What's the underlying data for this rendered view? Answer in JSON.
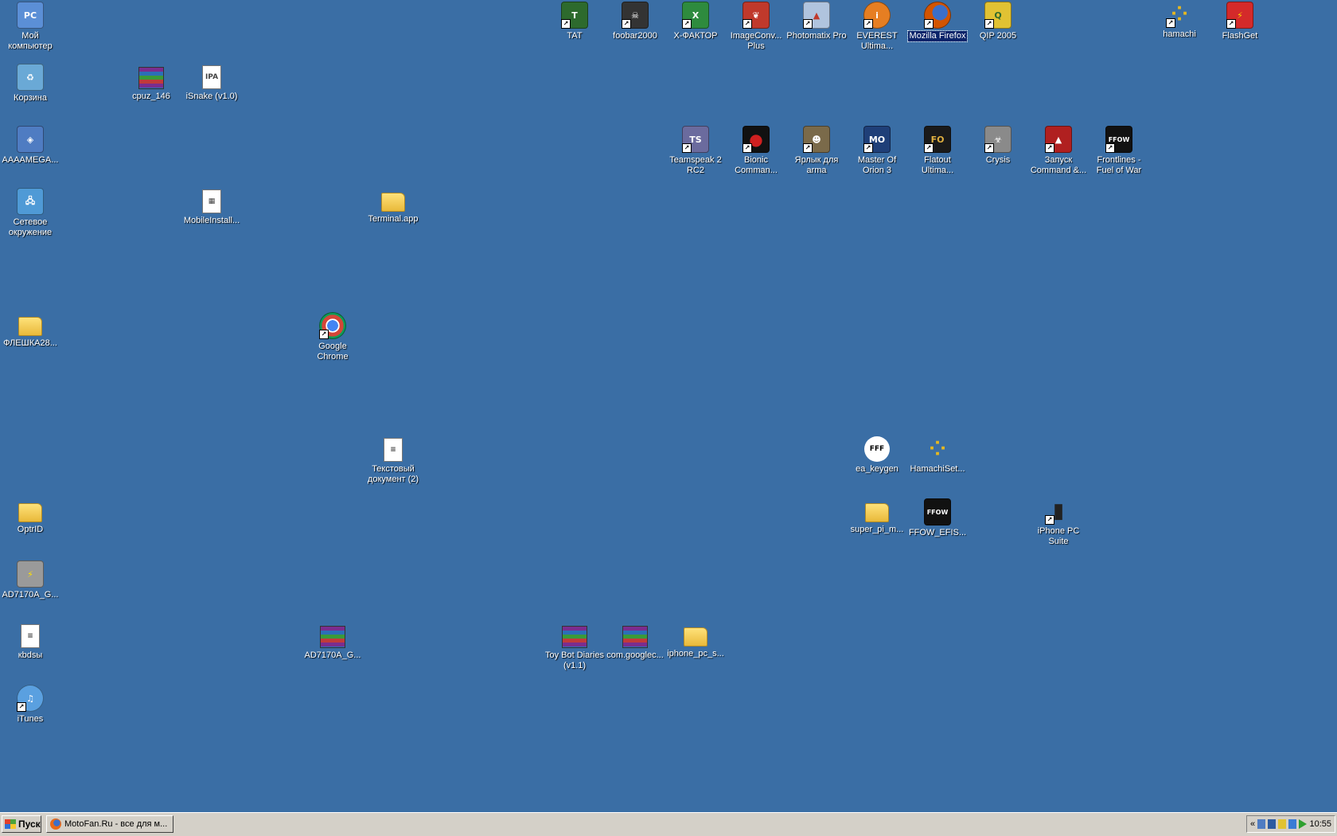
{
  "desktop": {
    "icons": [
      {
        "id": "my-computer",
        "label": "Мой компьютер",
        "glyph": "PC",
        "color": "#5b8fd6"
      },
      {
        "id": "recycle-bin",
        "label": "Корзина",
        "glyph": "♻",
        "color": "#6aa9d6"
      },
      {
        "id": "aaaamega",
        "label": "AAAAMEGA...",
        "glyph": "◈",
        "color": "#4f7cc2"
      },
      {
        "id": "network",
        "label": "Сетевое окружение",
        "glyph": "🖧",
        "color": "#4f9ad6"
      },
      {
        "id": "fleshka",
        "label": "ФЛЕШКА28...",
        "glyph": "",
        "color": ""
      },
      {
        "id": "optrid",
        "label": "OptrID",
        "glyph": "",
        "color": ""
      },
      {
        "id": "ad7170a-exe",
        "label": "AD7170A_G...",
        "glyph": "⚡",
        "color": "#9a9a9a"
      },
      {
        "id": "kbdsbi",
        "label": "кbdsы",
        "glyph": "≡",
        "color": ""
      },
      {
        "id": "itunes",
        "label": "iTunes",
        "glyph": "♫",
        "color": "#5aa0e0"
      },
      {
        "id": "cpuz",
        "label": "cpuz_146",
        "glyph": "",
        "color": ""
      },
      {
        "id": "isnake",
        "label": "iSnake (v1.0)",
        "glyph": "IPA",
        "color": ""
      },
      {
        "id": "mobileinstall",
        "label": "MobileInstall...",
        "glyph": "▦",
        "color": ""
      },
      {
        "id": "terminal-app",
        "label": "Terminal.app",
        "glyph": "",
        "color": ""
      },
      {
        "id": "google-chrome",
        "label": "Google Chrome",
        "glyph": "◉",
        "color": "#d44638"
      },
      {
        "id": "text-doc",
        "label": "Текстовый документ (2)",
        "glyph": "≡",
        "color": ""
      },
      {
        "id": "ad7170a-rar",
        "label": "AD7170A_G...",
        "glyph": "",
        "color": ""
      },
      {
        "id": "tat",
        "label": "TAT",
        "glyph": "T",
        "color": "#2d6a2d"
      },
      {
        "id": "foobar2000",
        "label": "foobar2000",
        "glyph": "☠",
        "color": "#333333"
      },
      {
        "id": "x-factor",
        "label": "X-ФАКТОР",
        "glyph": "X",
        "color": "#2e8b3e"
      },
      {
        "id": "imageconv",
        "label": "ImageConv... Plus",
        "glyph": "❦",
        "color": "#c0392b"
      },
      {
        "id": "photomatix",
        "label": "Photomatix Pro",
        "glyph": "▲",
        "color": "#b0c4de"
      },
      {
        "id": "everest",
        "label": "EVEREST Ultima...",
        "glyph": "i",
        "color": "#e67e22"
      },
      {
        "id": "firefox",
        "label": "Mozilla Firefox",
        "glyph": "●",
        "color": "#d35400"
      },
      {
        "id": "qip",
        "label": "QIP 2005",
        "glyph": "Q",
        "color": "#e1c233"
      },
      {
        "id": "hamachi",
        "label": "hamachi",
        "glyph": "⁘",
        "color": "#e6b820"
      },
      {
        "id": "flashget",
        "label": "FlashGet",
        "glyph": "⚡",
        "color": "#d42a2a"
      },
      {
        "id": "teamspeak",
        "label": "Teamspeak 2 RC2",
        "glyph": "TS",
        "color": "#6b6b9e"
      },
      {
        "id": "bionic",
        "label": "Bionic Comman...",
        "glyph": "●",
        "color": "#b01010"
      },
      {
        "id": "arma",
        "label": "Ярлык для arma",
        "glyph": "☻",
        "color": "#7a6a4a"
      },
      {
        "id": "moo3",
        "label": "Master Of Orion 3",
        "glyph": "MO",
        "color": "#1f3f78"
      },
      {
        "id": "flatout",
        "label": "Flatout Ultima...",
        "glyph": "FO",
        "color": "#1a1a1a"
      },
      {
        "id": "crysis",
        "label": "Crysis",
        "glyph": "☣",
        "color": "#8a8a8a"
      },
      {
        "id": "command-conquer",
        "label": "Запуск Command &...",
        "glyph": "▲",
        "color": "#b02020"
      },
      {
        "id": "ffow",
        "label": "Frontlines - Fuel of War",
        "glyph": "FFOW",
        "color": "#111111"
      },
      {
        "id": "ea-keygen",
        "label": "ea_keygen",
        "glyph": "FFF",
        "color": "#ffffff"
      },
      {
        "id": "hamachi-setup",
        "label": "HamachiSet...",
        "glyph": "⁘",
        "color": "#e6b820"
      },
      {
        "id": "super-pi",
        "label": "super_pi_m...",
        "glyph": "",
        "color": ""
      },
      {
        "id": "ffow-efis",
        "label": "FFOW_EFIS...",
        "glyph": "FFOW",
        "color": "#111111"
      },
      {
        "id": "iphone-pc-suite",
        "label": "iPhone PC Suite",
        "glyph": "▮",
        "color": "#222222"
      },
      {
        "id": "toy-bot",
        "label": "Toy Bot Diaries (v1.1)",
        "glyph": "",
        "color": ""
      },
      {
        "id": "com-google",
        "label": "com.googlec...",
        "glyph": "",
        "color": ""
      },
      {
        "id": "iphone-pc-s",
        "label": "iphone_pc_s...",
        "glyph": "",
        "color": ""
      }
    ]
  },
  "taskbar": {
    "start_label": "Пуск",
    "tasks": [
      {
        "label": "MotoFan.Ru - все для м..."
      }
    ],
    "tray": {
      "chevron": "«",
      "clock": "10:55"
    }
  }
}
